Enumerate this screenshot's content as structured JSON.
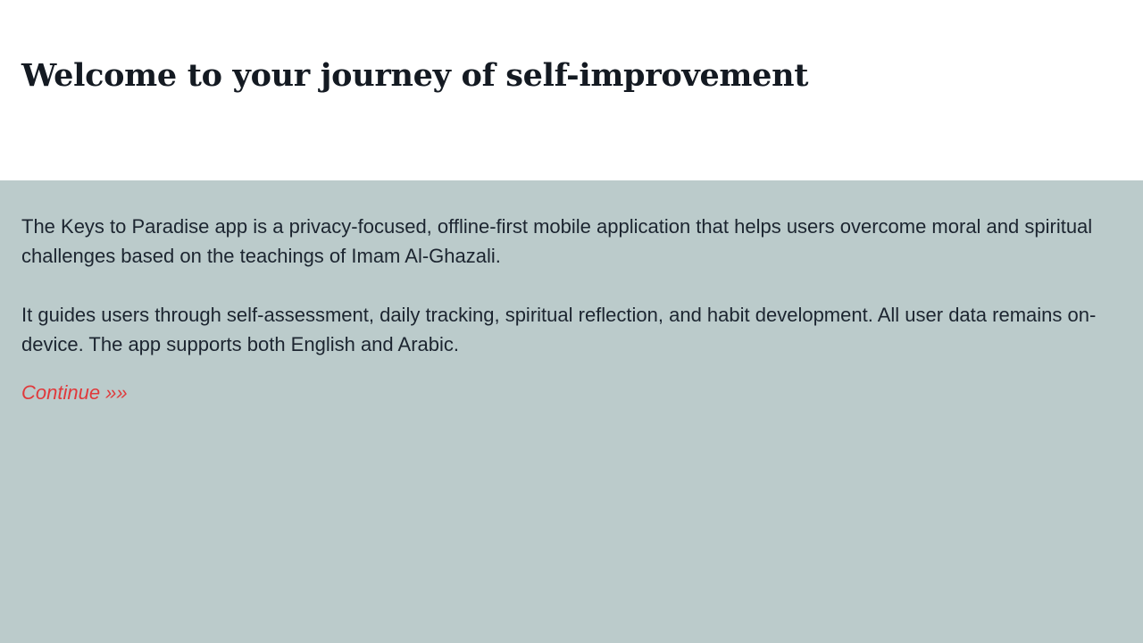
{
  "header": {
    "title": "Welcome to your journey of self-improvement"
  },
  "intro": {
    "paragraph_1": "The Keys to Paradise app is a privacy-focused, offline-first mobile application that helps users overcome moral and spiritual challenges based on the teachings of Imam Al-Ghazali.",
    "paragraph_2": "It guides users through self-assessment, daily tracking, spiritual reflection, and habit development. All user data remains on-device. The app supports both English and Arabic.",
    "continue_label": "Continue »»"
  },
  "colors": {
    "content_background": "#bbcbcb",
    "link": "#e0393b",
    "title": "#141a22",
    "text": "#1c2530"
  }
}
